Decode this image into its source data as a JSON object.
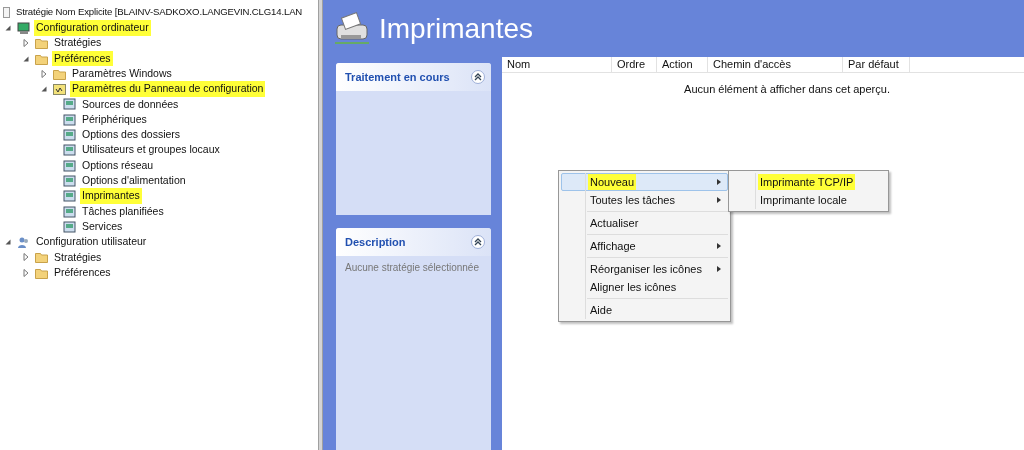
{
  "tree": {
    "title": "Stratégie Nom Explicite [BLAINV-SADKOXO.LANGEVIN.CLG14.LAN",
    "items": [
      {
        "label": "Configuration ordinateur",
        "kind": "computer",
        "expanded": true,
        "highlighted": true,
        "children": [
          {
            "label": "Stratégies",
            "kind": "folder",
            "expanded": false,
            "highlighted": false
          },
          {
            "label": "Préférences",
            "kind": "folder",
            "expanded": true,
            "highlighted": true,
            "children": [
              {
                "label": "Paramètres Windows",
                "kind": "folder",
                "expanded": false,
                "highlighted": false
              },
              {
                "label": "Paramètres du Panneau de configuration",
                "kind": "panel",
                "expanded": true,
                "highlighted": true,
                "children": [
                  {
                    "label": "Sources de données",
                    "kind": "setting",
                    "highlighted": false
                  },
                  {
                    "label": "Périphériques",
                    "kind": "setting",
                    "highlighted": false
                  },
                  {
                    "label": "Options des dossiers",
                    "kind": "setting",
                    "highlighted": false
                  },
                  {
                    "label": "Utilisateurs et groupes locaux",
                    "kind": "setting",
                    "highlighted": false
                  },
                  {
                    "label": "Options réseau",
                    "kind": "setting",
                    "highlighted": false
                  },
                  {
                    "label": "Options d'alimentation",
                    "kind": "setting",
                    "highlighted": false
                  },
                  {
                    "label": "Imprimantes",
                    "kind": "setting",
                    "highlighted": true
                  },
                  {
                    "label": "Tâches planifiées",
                    "kind": "setting",
                    "highlighted": false
                  },
                  {
                    "label": "Services",
                    "kind": "setting",
                    "highlighted": false
                  }
                ]
              }
            ]
          }
        ]
      },
      {
        "label": "Configuration utilisateur",
        "kind": "user",
        "expanded": true,
        "highlighted": false,
        "children": [
          {
            "label": "Stratégies",
            "kind": "folder",
            "expanded": false,
            "highlighted": false
          },
          {
            "label": "Préférences",
            "kind": "folder",
            "expanded": false,
            "highlighted": false
          }
        ]
      }
    ]
  },
  "header": {
    "title": "Imprimantes"
  },
  "panels": [
    {
      "title": "Traitement en cours"
    },
    {
      "title": "Description",
      "text": "Aucune stratégie sélectionnée"
    }
  ],
  "table": {
    "columns": [
      "Nom",
      "Ordre",
      "Action",
      "Chemin d'accès",
      "Par défaut"
    ],
    "empty_message": "Aucun élément à afficher dans cet aperçu."
  },
  "context_menu": {
    "groups": [
      [
        {
          "label": "Nouveau",
          "submenu": true,
          "selected": true,
          "highlighted": true
        },
        {
          "label": "Toutes les tâches",
          "submenu": true,
          "selected": false,
          "highlighted": false
        }
      ],
      [
        {
          "label": "Actualiser",
          "submenu": false,
          "selected": false,
          "highlighted": false
        }
      ],
      [
        {
          "label": "Affichage",
          "submenu": true,
          "selected": false,
          "highlighted": false
        }
      ],
      [
        {
          "label": "Réorganiser les icônes",
          "submenu": true,
          "selected": false,
          "highlighted": false
        },
        {
          "label": "Aligner les icônes",
          "submenu": false,
          "selected": false,
          "highlighted": false
        }
      ],
      [
        {
          "label": "Aide",
          "submenu": false,
          "selected": false,
          "highlighted": false
        }
      ]
    ]
  },
  "submenu": {
    "items": [
      {
        "label": "Imprimante TCP/IP",
        "highlighted": true
      },
      {
        "label": "Imprimante locale",
        "highlighted": false
      }
    ]
  }
}
